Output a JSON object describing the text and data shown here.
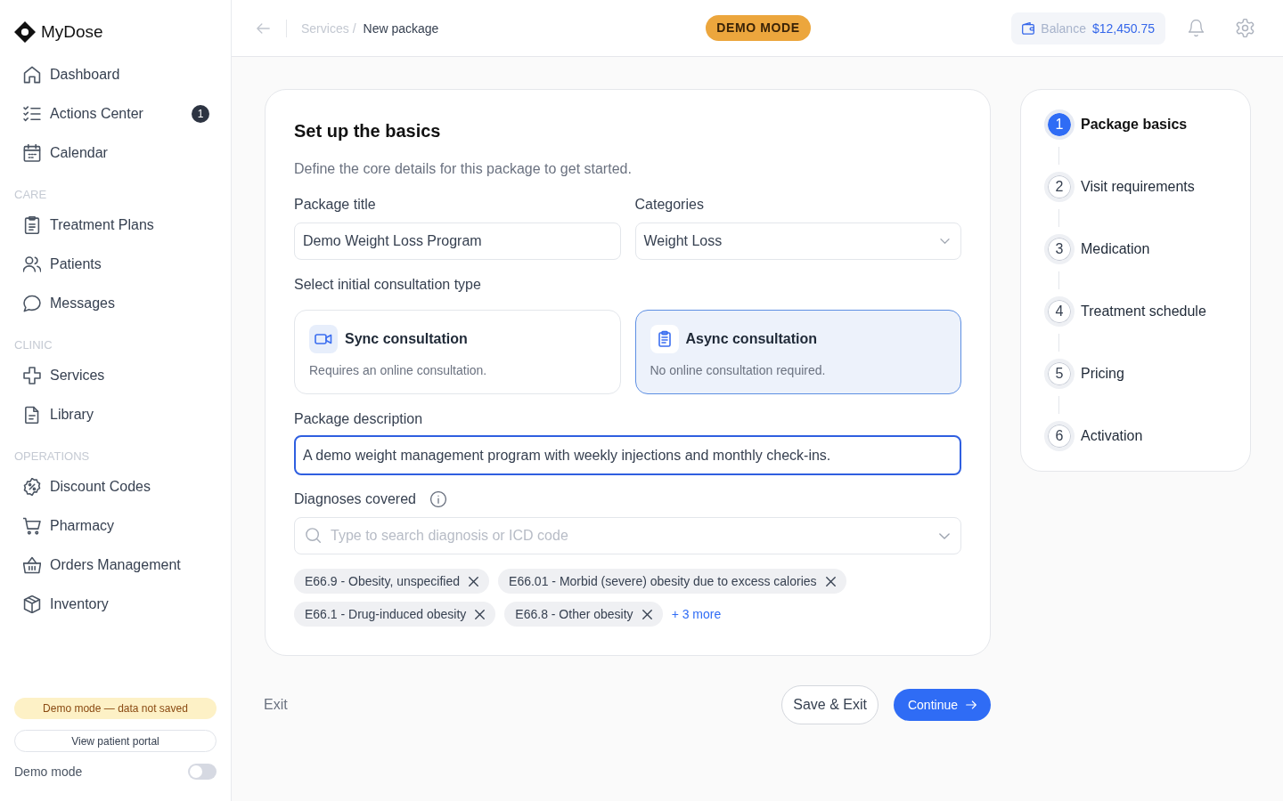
{
  "sidebar": {
    "logo": "MyDose",
    "sections": [
      {
        "items": [
          {
            "label": "Dashboard",
            "selected": false
          },
          {
            "label": "Actions Center",
            "badge": "1",
            "selected": false
          },
          {
            "label": "Calendar",
            "selected": false
          }
        ]
      },
      {
        "heading": "CARE",
        "items": [
          {
            "label": "Treatment Plans",
            "selected": false
          },
          {
            "label": "Patients",
            "selected": false
          },
          {
            "label": "Messages",
            "selected": false
          }
        ]
      },
      {
        "heading": "CLINIC",
        "items": [
          {
            "label": "Services",
            "selected": false
          },
          {
            "label": "Library",
            "selected": false
          }
        ]
      },
      {
        "heading": "OPERATIONS",
        "items": [
          {
            "label": "Discount Codes",
            "selected": false
          },
          {
            "label": "Pharmacy",
            "selected": false
          },
          {
            "label": "Orders Management",
            "selected": false
          },
          {
            "label": "Inventory",
            "selected": false
          }
        ]
      }
    ],
    "demo_notice": "Demo mode — data not saved",
    "portal_button": "View patient portal",
    "demo_toggle": {
      "label": "Demo mode",
      "on": false
    }
  },
  "topbar": {
    "breadcrumb": {
      "parent": "Services",
      "separator": "/",
      "current": "New package"
    },
    "mode_badge": "DEMO MODE",
    "balance": {
      "label": "Balance",
      "amount": "$12,450.75"
    }
  },
  "form": {
    "title": "Set up the basics",
    "subtitle": "Define the core details for this package to get started.",
    "package_title": {
      "label": "Package title",
      "value": "Demo Weight Loss Program"
    },
    "categories": {
      "label": "Categories",
      "value": "Weight Loss"
    },
    "consultation": {
      "label": "Select initial consultation type",
      "options": [
        {
          "title": "Sync consultation",
          "description": "Requires an online consultation.",
          "selected": false
        },
        {
          "title": "Async consultation",
          "description": "No online consultation required.",
          "selected": true
        }
      ]
    },
    "description": {
      "label": "Package description",
      "value": "A demo weight management program with weekly injections and monthly check-ins.",
      "focused": true
    },
    "diagnoses": {
      "label": "Diagnoses covered",
      "placeholder": "Type to search diagnosis or ICD code",
      "tags": [
        "E66.9 - Obesity, unspecified",
        "E66.01 - Morbid (severe) obesity due to excess calories",
        "E66.1 - Drug-induced obesity",
        "E66.8 - Other obesity"
      ],
      "more": "+ 3 more"
    }
  },
  "footer": {
    "exit": "Exit",
    "save_exit": "Save & Exit",
    "continue": "Continue"
  },
  "stepper": {
    "steps": [
      {
        "number": "1",
        "label": "Package basics",
        "selected": true
      },
      {
        "number": "2",
        "label": "Visit requirements",
        "selected": false
      },
      {
        "number": "3",
        "label": "Medication",
        "selected": false
      },
      {
        "number": "4",
        "label": "Treatment schedule",
        "selected": false
      },
      {
        "number": "5",
        "label": "Pricing",
        "selected": false
      },
      {
        "number": "6",
        "label": "Activation",
        "selected": false
      }
    ]
  }
}
